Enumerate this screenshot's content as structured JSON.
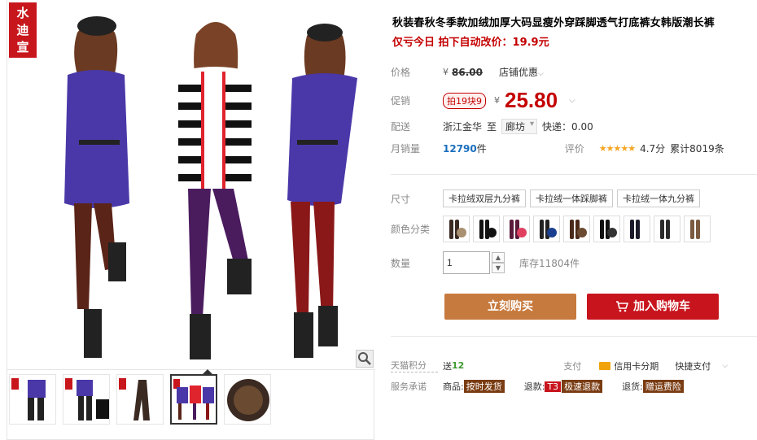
{
  "brand": {
    "logo_text": [
      "水",
      "迪",
      "宣"
    ]
  },
  "product": {
    "title": "秋装春秋冬季款加绒加厚大码显瘦外穿踩脚透气打底裤女韩版潮长裤",
    "promo_line": "仅亏今日 拍下自动改价：19.9元"
  },
  "price": {
    "label": "价格",
    "currency": "¥",
    "original": "86.00",
    "shop_promo": "店铺优惠"
  },
  "promo": {
    "label": "促销",
    "tag": "拍19块9",
    "currency": "¥",
    "price": "25.80"
  },
  "shipping": {
    "label": "配送",
    "from": "浙江金华",
    "to_word": "至",
    "to": "廊坊",
    "fee": "快递：0.00"
  },
  "sales": {
    "label": "月销量",
    "count": "12790",
    "unit": "件",
    "rating_label": "评价",
    "stars": "★★★★★",
    "score": "4.7分",
    "total": "累计8019条"
  },
  "size": {
    "label": "尺寸",
    "options": [
      "卡拉绒双层九分裤",
      "卡拉绒一体踩脚裤",
      "卡拉绒一体九分裤"
    ]
  },
  "color": {
    "label": "颜色分类",
    "swatches": [
      {
        "leg": "#3a2a22",
        "dot": "#a89070"
      },
      {
        "leg": "#111111",
        "dot": "#111111"
      },
      {
        "leg": "#5a1a3a",
        "dot": "#e04060"
      },
      {
        "leg": "#222222",
        "dot": "#1b3f8f"
      },
      {
        "leg": "#4a2a1a",
        "dot": "#6a4a30"
      },
      {
        "leg": "#111111",
        "dot": "#333333"
      },
      {
        "leg": "#1a1a2a",
        "dot": null
      },
      {
        "leg": "#2a2a2a",
        "dot": null
      },
      {
        "leg": "#7a5a40",
        "dot": null
      }
    ]
  },
  "quantity": {
    "label": "数量",
    "value": "1",
    "stock": "库存11804件"
  },
  "buttons": {
    "buy_now": "立刻购买",
    "add_to_cart": "加入购物车"
  },
  "footer": {
    "points_label": "天猫积分",
    "points_value_prefix": "送",
    "points_value": "12",
    "pay_label": "支付",
    "credit_card": "信用卡分期",
    "quick_pay": "快捷支付",
    "service_label": "服务承诺",
    "goods_label": "商品:",
    "goods_tag": "按时发货",
    "refund_label": "退款:",
    "refund_t3": "T3",
    "refund_tag": "极速退款",
    "return_label": "退货:",
    "return_tag": "赠运费险"
  }
}
